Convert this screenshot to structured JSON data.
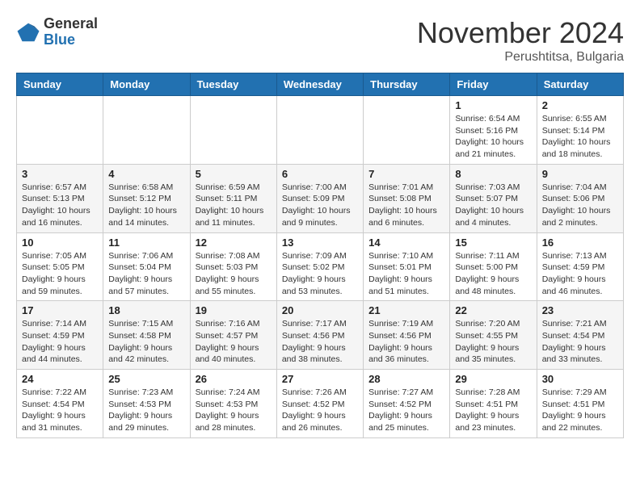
{
  "header": {
    "logo_general": "General",
    "logo_blue": "Blue",
    "month": "November 2024",
    "location": "Perushtitsa, Bulgaria"
  },
  "weekdays": [
    "Sunday",
    "Monday",
    "Tuesday",
    "Wednesday",
    "Thursday",
    "Friday",
    "Saturday"
  ],
  "weeks": [
    [
      {
        "day": "",
        "info": ""
      },
      {
        "day": "",
        "info": ""
      },
      {
        "day": "",
        "info": ""
      },
      {
        "day": "",
        "info": ""
      },
      {
        "day": "",
        "info": ""
      },
      {
        "day": "1",
        "info": "Sunrise: 6:54 AM\nSunset: 5:16 PM\nDaylight: 10 hours\nand 21 minutes."
      },
      {
        "day": "2",
        "info": "Sunrise: 6:55 AM\nSunset: 5:14 PM\nDaylight: 10 hours\nand 18 minutes."
      }
    ],
    [
      {
        "day": "3",
        "info": "Sunrise: 6:57 AM\nSunset: 5:13 PM\nDaylight: 10 hours\nand 16 minutes."
      },
      {
        "day": "4",
        "info": "Sunrise: 6:58 AM\nSunset: 5:12 PM\nDaylight: 10 hours\nand 14 minutes."
      },
      {
        "day": "5",
        "info": "Sunrise: 6:59 AM\nSunset: 5:11 PM\nDaylight: 10 hours\nand 11 minutes."
      },
      {
        "day": "6",
        "info": "Sunrise: 7:00 AM\nSunset: 5:09 PM\nDaylight: 10 hours\nand 9 minutes."
      },
      {
        "day": "7",
        "info": "Sunrise: 7:01 AM\nSunset: 5:08 PM\nDaylight: 10 hours\nand 6 minutes."
      },
      {
        "day": "8",
        "info": "Sunrise: 7:03 AM\nSunset: 5:07 PM\nDaylight: 10 hours\nand 4 minutes."
      },
      {
        "day": "9",
        "info": "Sunrise: 7:04 AM\nSunset: 5:06 PM\nDaylight: 10 hours\nand 2 minutes."
      }
    ],
    [
      {
        "day": "10",
        "info": "Sunrise: 7:05 AM\nSunset: 5:05 PM\nDaylight: 9 hours\nand 59 minutes."
      },
      {
        "day": "11",
        "info": "Sunrise: 7:06 AM\nSunset: 5:04 PM\nDaylight: 9 hours\nand 57 minutes."
      },
      {
        "day": "12",
        "info": "Sunrise: 7:08 AM\nSunset: 5:03 PM\nDaylight: 9 hours\nand 55 minutes."
      },
      {
        "day": "13",
        "info": "Sunrise: 7:09 AM\nSunset: 5:02 PM\nDaylight: 9 hours\nand 53 minutes."
      },
      {
        "day": "14",
        "info": "Sunrise: 7:10 AM\nSunset: 5:01 PM\nDaylight: 9 hours\nand 51 minutes."
      },
      {
        "day": "15",
        "info": "Sunrise: 7:11 AM\nSunset: 5:00 PM\nDaylight: 9 hours\nand 48 minutes."
      },
      {
        "day": "16",
        "info": "Sunrise: 7:13 AM\nSunset: 4:59 PM\nDaylight: 9 hours\nand 46 minutes."
      }
    ],
    [
      {
        "day": "17",
        "info": "Sunrise: 7:14 AM\nSunset: 4:59 PM\nDaylight: 9 hours\nand 44 minutes."
      },
      {
        "day": "18",
        "info": "Sunrise: 7:15 AM\nSunset: 4:58 PM\nDaylight: 9 hours\nand 42 minutes."
      },
      {
        "day": "19",
        "info": "Sunrise: 7:16 AM\nSunset: 4:57 PM\nDaylight: 9 hours\nand 40 minutes."
      },
      {
        "day": "20",
        "info": "Sunrise: 7:17 AM\nSunset: 4:56 PM\nDaylight: 9 hours\nand 38 minutes."
      },
      {
        "day": "21",
        "info": "Sunrise: 7:19 AM\nSunset: 4:56 PM\nDaylight: 9 hours\nand 36 minutes."
      },
      {
        "day": "22",
        "info": "Sunrise: 7:20 AM\nSunset: 4:55 PM\nDaylight: 9 hours\nand 35 minutes."
      },
      {
        "day": "23",
        "info": "Sunrise: 7:21 AM\nSunset: 4:54 PM\nDaylight: 9 hours\nand 33 minutes."
      }
    ],
    [
      {
        "day": "24",
        "info": "Sunrise: 7:22 AM\nSunset: 4:54 PM\nDaylight: 9 hours\nand 31 minutes."
      },
      {
        "day": "25",
        "info": "Sunrise: 7:23 AM\nSunset: 4:53 PM\nDaylight: 9 hours\nand 29 minutes."
      },
      {
        "day": "26",
        "info": "Sunrise: 7:24 AM\nSunset: 4:53 PM\nDaylight: 9 hours\nand 28 minutes."
      },
      {
        "day": "27",
        "info": "Sunrise: 7:26 AM\nSunset: 4:52 PM\nDaylight: 9 hours\nand 26 minutes."
      },
      {
        "day": "28",
        "info": "Sunrise: 7:27 AM\nSunset: 4:52 PM\nDaylight: 9 hours\nand 25 minutes."
      },
      {
        "day": "29",
        "info": "Sunrise: 7:28 AM\nSunset: 4:51 PM\nDaylight: 9 hours\nand 23 minutes."
      },
      {
        "day": "30",
        "info": "Sunrise: 7:29 AM\nSunset: 4:51 PM\nDaylight: 9 hours\nand 22 minutes."
      }
    ]
  ]
}
